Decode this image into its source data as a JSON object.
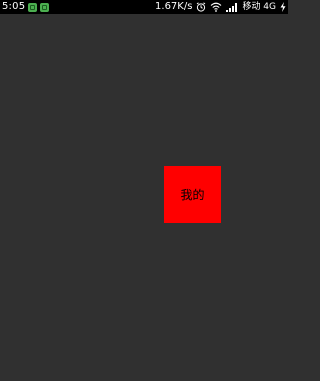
{
  "status_bar": {
    "time": "5:05",
    "network_speed": "1.67K/s",
    "carrier": "移动 4G",
    "icons": [
      "app-notification-icon",
      "app-notification-icon",
      "alarm-icon",
      "wifi-icon",
      "signal-icon",
      "charging-icon"
    ]
  },
  "main": {
    "box_label": "我的",
    "box_color": "#ff0000",
    "background_color": "#303030"
  }
}
